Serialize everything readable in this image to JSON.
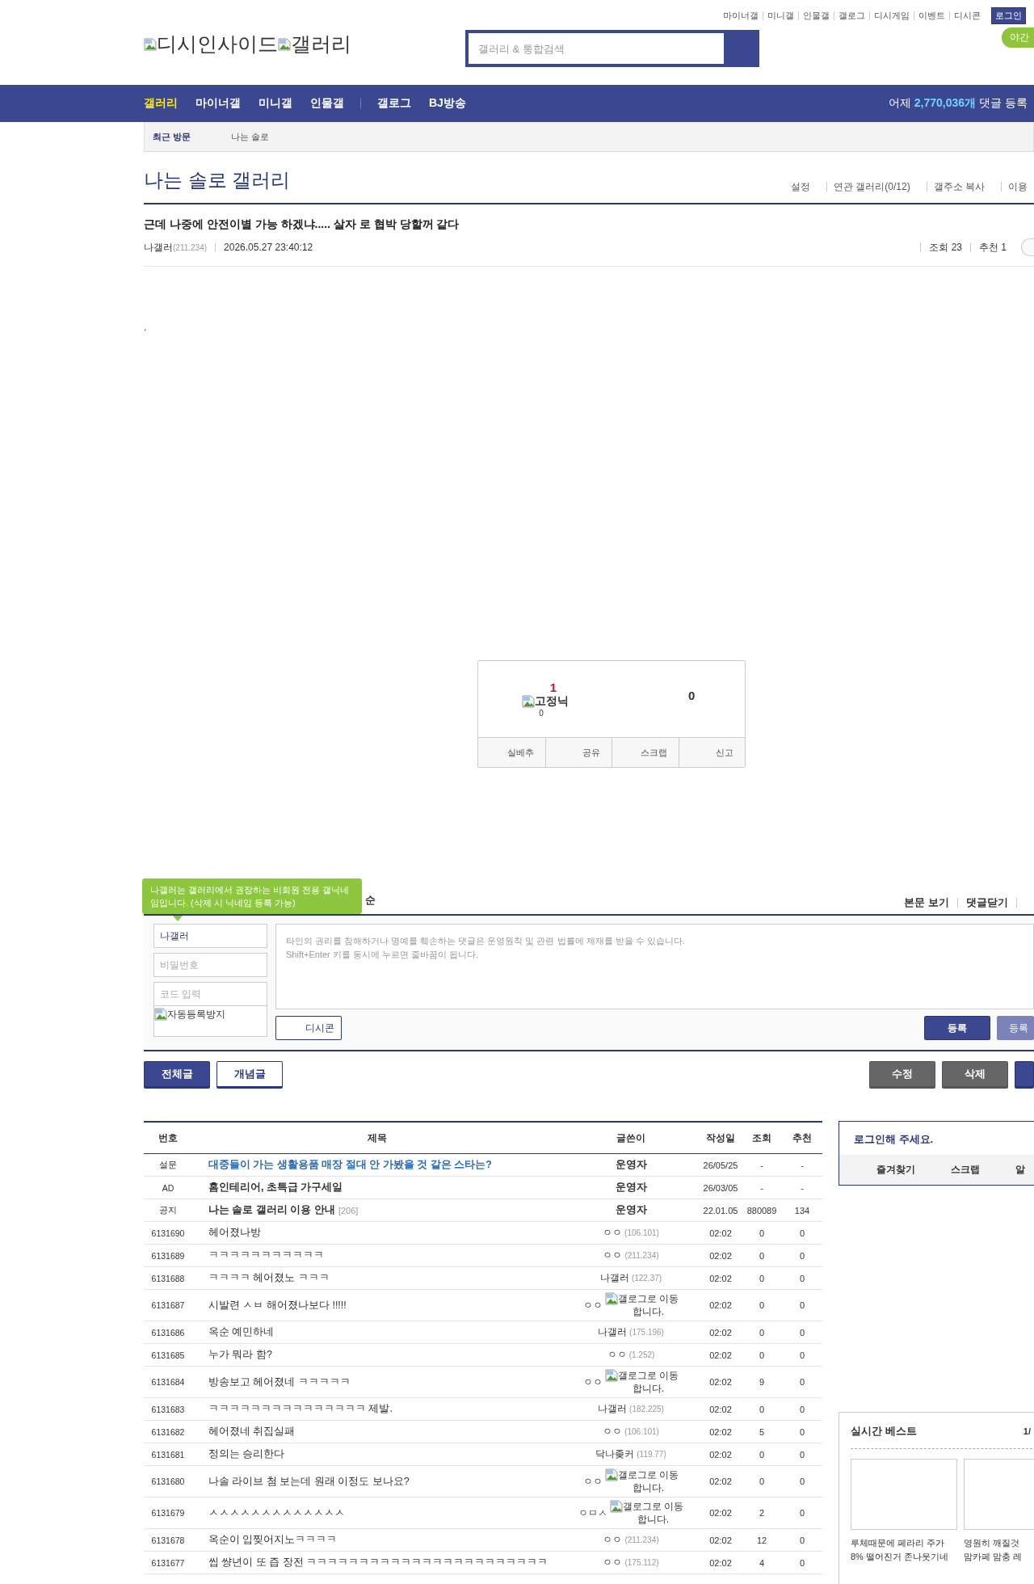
{
  "top_links": [
    "마이너갤",
    "미니갤",
    "인물갤",
    "갤로그",
    "디시게임",
    "이벤트",
    "디시콘"
  ],
  "login_button": "로그인",
  "night_mode_button": "야간",
  "logo": {
    "site": "디시인사이드",
    "section": "갤러리"
  },
  "search": {
    "placeholder": "갤러리 & 통합검색"
  },
  "nav": {
    "groups": [
      [
        {
          "label": "갤러리",
          "selected": true
        },
        {
          "label": "마이너갤",
          "selected": false
        },
        {
          "label": "미니갤",
          "selected": false
        },
        {
          "label": "인물갤",
          "selected": false
        }
      ],
      [
        {
          "label": "갤로그",
          "selected": false
        },
        {
          "label": "BJ방송",
          "selected": false
        }
      ]
    ]
  },
  "stats": {
    "prefix": "어제",
    "count": "2,770,036개",
    "suffix": "댓글 등록"
  },
  "recent": {
    "label": "최근 방문",
    "items": [
      "나는 솔로"
    ]
  },
  "gallery": {
    "title": "나는 솔로 갤러리",
    "links": [
      "설정",
      "연관 갤러리(0/12)",
      "갤주소 복사",
      "이용"
    ]
  },
  "post": {
    "title": "근데 나중에 안전이별 가능 하겠냐..... 살자 로 협박 당할꺼 같다",
    "author": "나갤러",
    "ip": "(211.234)",
    "date": "2026.05.27 23:40:12",
    "views": "조회 23",
    "recommends": "추천 1",
    "body": "."
  },
  "vote": {
    "up": "1",
    "fixed_nick": "고정닉",
    "fixed_count": "0",
    "down": "0",
    "actions": [
      "실베추",
      "공유",
      "스크랩",
      "신고"
    ]
  },
  "comments": {
    "tooltip": "나갤러는 갤러리에서 권장하는 비회원 전용 갤닉네임입니다. (삭제 시 닉네임 등록 가능)",
    "sort_fragment": "순",
    "links": [
      "본문 보기",
      "댓글닫기"
    ],
    "nickname": "나갤러",
    "password_placeholder": "비밀번호",
    "code_placeholder": "코드 입력",
    "captcha_alt": "자동등록방지",
    "textarea_placeholder": "타인의 권리를 침해하거나 명예를 훼손하는 댓글은 운영원칙 및 관련 법률에 제재를 받을 수 있습니다.\nShift+Enter 키를 동시에 누르면 줄바꿈이 됩니다.",
    "dccon_button": "디시콘",
    "submit_buttons": [
      {
        "label": "등록",
        "kind": "primary"
      },
      {
        "label": "등록",
        "kind": "secondary"
      }
    ]
  },
  "list_tabs": [
    {
      "label": "전체글",
      "selected": true
    },
    {
      "label": "개념글",
      "selected": false
    }
  ],
  "post_actions": [
    {
      "label": "수정",
      "kind": "gray"
    },
    {
      "label": "삭제",
      "kind": "gray"
    },
    {
      "kind": "blue"
    }
  ],
  "table": {
    "columns": [
      "번호",
      "제목",
      "글쓴이",
      "작성일",
      "조회",
      "추천"
    ],
    "rows": [
      {
        "kind": "survey",
        "number": "설문",
        "title": "대중들이 가는 생활용품 매장 절대 안 가봤을 것 같은 스타는?",
        "writer": "운영자",
        "date": "26/05/25",
        "views": "-",
        "recommends": "-"
      },
      {
        "kind": "ad",
        "number": "AD",
        "title": "홈인테리어, 초특급 가구세일",
        "writer": "운영자",
        "date": "26/03/05",
        "views": "-",
        "recommends": "-"
      },
      {
        "kind": "notice",
        "number": "공지",
        "title": "나는 솔로 갤러리 이용 안내",
        "comment_count": "[206]",
        "writer": "운영자",
        "date": "22.01.05",
        "views": "880089",
        "recommends": "134"
      },
      {
        "kind": "normal",
        "number": "6131690",
        "title": "헤어졌나방",
        "writer": "ㅇㅇ",
        "ip": "(106.101)",
        "date": "02:02",
        "views": "0",
        "recommends": "0"
      },
      {
        "kind": "normal",
        "number": "6131689",
        "title": "ㅋㅋㅋㅋㅋㅋㅋㅋㅋㅋㅋ",
        "writer": "ㅇㅇ",
        "ip": "(211.234)",
        "date": "02:02",
        "views": "0",
        "recommends": "0"
      },
      {
        "kind": "normal",
        "number": "6131688",
        "title": "ㅋㅋㅋㅋ 헤어졌노 ㅋㅋㅋ",
        "writer": "나갤러",
        "ip": "(122.37)",
        "date": "02:02",
        "views": "0",
        "recommends": "0"
      },
      {
        "kind": "normal",
        "number": "6131687",
        "title": "시발련 ㅅㅂ 해어졌나보다 !!!!!",
        "writer": "ㅇㅇ",
        "gallog_alt": "갤로그로 이동합니다.",
        "date": "02:02",
        "views": "0",
        "recommends": "0"
      },
      {
        "kind": "normal",
        "number": "6131686",
        "title": "옥순 예민하네",
        "writer": "나갤러",
        "ip": "(175.196)",
        "date": "02:02",
        "views": "0",
        "recommends": "0"
      },
      {
        "kind": "normal",
        "number": "6131685",
        "title": "누가 뭐라 함?",
        "writer": "ㅇㅇ",
        "ip": "(1.252)",
        "date": "02:02",
        "views": "0",
        "recommends": "0"
      },
      {
        "kind": "normal",
        "number": "6131684",
        "title": "방송보고 헤어졌네 ㅋㅋㅋㅋㅋ",
        "writer": "ㅇㅇ",
        "gallog_alt": "갤로그로 이동합니다.",
        "date": "02:02",
        "views": "9",
        "recommends": "0"
      },
      {
        "kind": "normal",
        "number": "6131683",
        "title": "ㅋㅋㅋㅋㅋㅋㅋㅋㅋㅋㅋㅋㅋㅋㅋ 제발.",
        "writer": "나갤러",
        "ip": "(182.225)",
        "date": "02:02",
        "views": "0",
        "recommends": "0"
      },
      {
        "kind": "normal",
        "number": "6131682",
        "title": "헤어졌네 취집실패",
        "writer": "ㅇㅇ",
        "ip": "(106.101)",
        "date": "02:02",
        "views": "5",
        "recommends": "0"
      },
      {
        "kind": "normal",
        "number": "6131681",
        "title": "정의는 승리한다",
        "writer": "닥나좆커",
        "ip": "(119.77)",
        "date": "02:02",
        "views": "0",
        "recommends": "0"
      },
      {
        "kind": "normal",
        "number": "6131680",
        "title": "나솔 라이브 첨 보는데 원래 이정도 보나요?",
        "writer": "ㅇㅇ",
        "gallog_alt": "갤로그로 이동합니다.",
        "date": "02:02",
        "views": "0",
        "recommends": "0"
      },
      {
        "kind": "normal",
        "number": "6131679",
        "title": "ㅅㅅㅅㅅㅅㅅㅅㅅㅅㅅㅅㅅㅅ",
        "writer": "ㅇㅁㅅ",
        "gallog_alt": "갤로그로 이동합니다.",
        "date": "02:02",
        "views": "2",
        "recommends": "0"
      },
      {
        "kind": "normal",
        "number": "6131678",
        "title": "옥순이 입찢어지노ㅋㅋㅋㅋ",
        "writer": "ㅇㅇ",
        "ip": "(211.234)",
        "date": "02:02",
        "views": "12",
        "recommends": "0"
      },
      {
        "kind": "normal",
        "number": "6131677",
        "title": "씹 썅년이 또 즙 장전 ㅋㅋㅋㅋㅋㅋㅋㅋㅋㅋㅋㅋㅋㅋㅋㅋㅋㅋㅋㅋㅋㅋㅋ",
        "writer": "ㅇㅇ",
        "ip": "(175.112)",
        "date": "02:02",
        "views": "4",
        "recommends": "0"
      }
    ]
  },
  "sidebar": {
    "login_prompt": "로그인해 주세요.",
    "tabs": [
      "즐겨찾기",
      "스크랩",
      "알"
    ],
    "best": {
      "title": "실시간 베스트",
      "page": "1/",
      "cards": [
        {
          "caption_lines": [
            "루체때문에 페라리 주가",
            "8% 떨어진거 존나웃기네"
          ]
        },
        {
          "caption_lines": [
            "영원히 깨질것",
            "맘카페 맘충 레"
          ]
        }
      ]
    }
  }
}
